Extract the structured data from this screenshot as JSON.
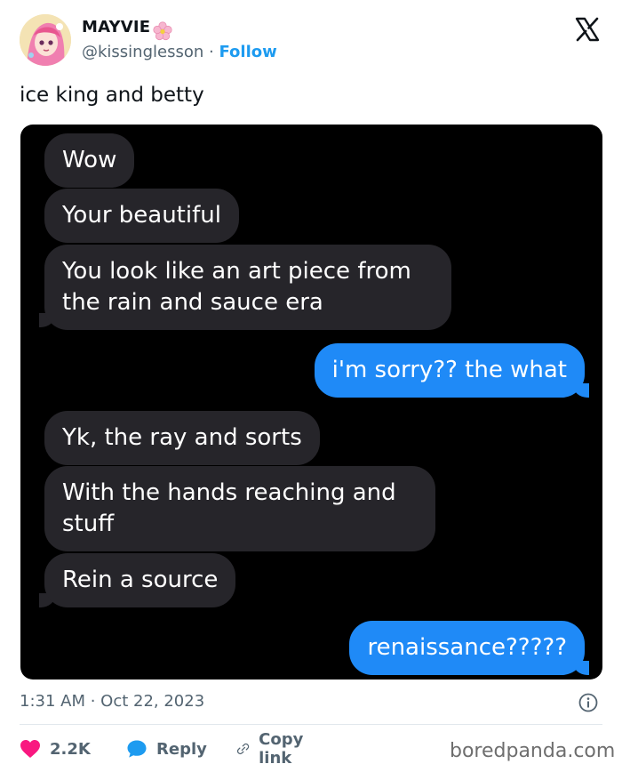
{
  "tweet": {
    "display_name": "MAYVIE",
    "handle": "@kissinglesson",
    "separator": "·",
    "follow_label": "Follow",
    "text": "ice king and betty",
    "timestamp": "1:31 AM · Oct 22, 2023",
    "likes": "2.2K",
    "reply_label": "Reply",
    "copy_link_label": "Copy link"
  },
  "messages": [
    {
      "side": "in",
      "text": "Wow"
    },
    {
      "side": "in",
      "text": "Your beautiful"
    },
    {
      "side": "in",
      "text": "You look like an art piece from the rain and sauce era"
    },
    {
      "side": "out",
      "text": "i'm sorry?? the what"
    },
    {
      "side": "in",
      "text": "Yk, the ray and sorts"
    },
    {
      "side": "in",
      "text": "With the hands reaching and stuff"
    },
    {
      "side": "in",
      "text": "Rein a source"
    },
    {
      "side": "out",
      "text": "renaissance?????"
    }
  ],
  "watermark": "boredpanda.com",
  "colors": {
    "accent": "#1d9bf0",
    "like_heart": "#f91880",
    "incoming_bubble": "#26252a",
    "outgoing_bubble": "#1f8af7"
  },
  "icons": [
    "avatar",
    "flower-emoji-icon",
    "x-logo-icon",
    "info-icon",
    "heart-icon",
    "reply-bubble-icon",
    "link-icon"
  ]
}
